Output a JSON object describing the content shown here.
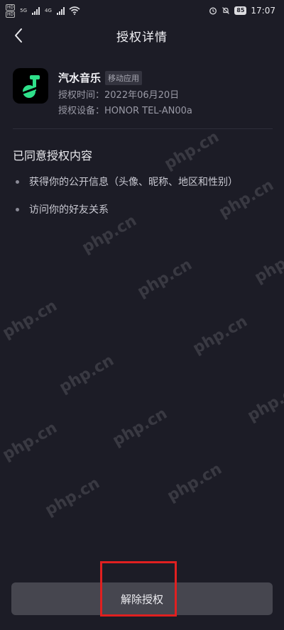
{
  "status_bar": {
    "badges": [
      "HD",
      "HD"
    ],
    "net_labels": [
      "5G",
      "4G"
    ],
    "battery": "85",
    "time": "17:07"
  },
  "header": {
    "title": "授权详情"
  },
  "app": {
    "name": "汽水音乐",
    "type_tag": "移动应用",
    "auth_time": "授权时间：2022年06月20日",
    "auth_device": "授权设备：HONOR TEL-AN00a"
  },
  "permissions": {
    "title": "已同意授权内容",
    "items": [
      "获得你的公开信息（头像、昵称、地区和性别）",
      "访问你的好友关系"
    ]
  },
  "watermark": "php.cn",
  "action": {
    "revoke_label": "解除授权"
  },
  "colors": {
    "background": "#1c1c26",
    "button": "#46464f",
    "highlight": "#e02020",
    "app_icon_green": "#2fe08a"
  }
}
